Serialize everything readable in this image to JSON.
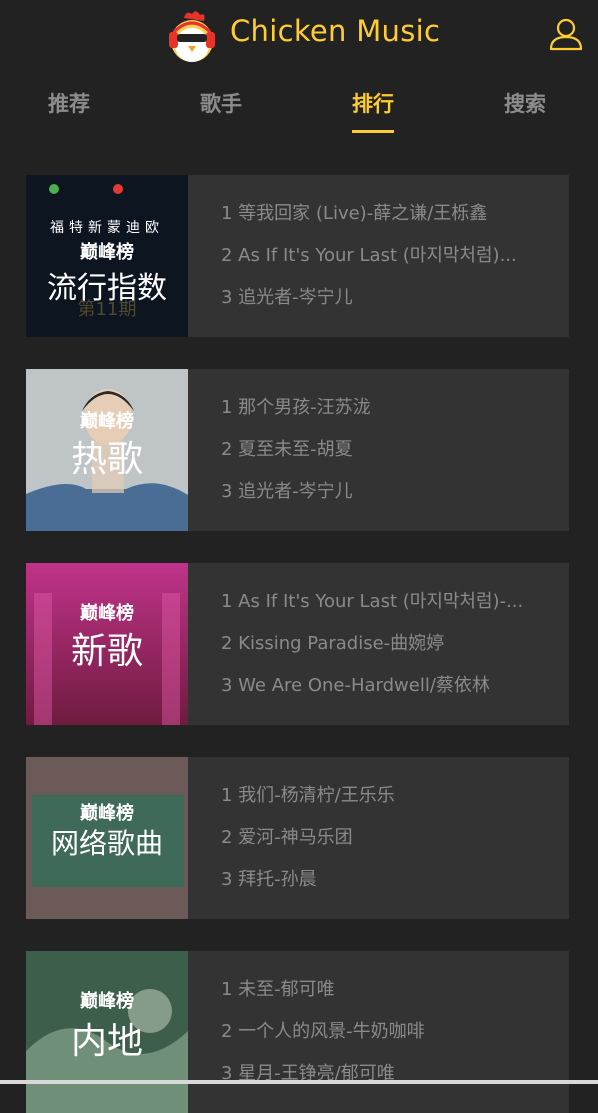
{
  "app": {
    "title": "Chicken Music",
    "logo_icon": "chicken-logo-icon",
    "user_icon": "user-icon"
  },
  "colors": {
    "accent": "#ffcd32",
    "background": "#222222",
    "card": "#333333",
    "text_muted": "#8a8a8a"
  },
  "tabs": [
    {
      "label": "推荐",
      "active": false
    },
    {
      "label": "歌手",
      "active": false
    },
    {
      "label": "排行",
      "active": true
    },
    {
      "label": "搜索",
      "active": false
    }
  ],
  "ranks": [
    {
      "cover_title": "流行指数",
      "cover_top": "福特新蒙迪欧",
      "cover_brand": "巅峰榜",
      "cover_issue": "第11期",
      "songs": [
        "1 等我回家 (Live)-薛之谦/王栎鑫",
        "2 As If It's Your Last (마지막처럼)...",
        "3 追光者-岑宁儿"
      ]
    },
    {
      "cover_title": "热歌",
      "cover_brand": "巅峰榜",
      "songs": [
        "1 那个男孩-汪苏泷",
        "2 夏至未至-胡夏",
        "3 追光者-岑宁儿"
      ]
    },
    {
      "cover_title": "新歌",
      "cover_brand": "巅峰榜",
      "songs": [
        "1 As If It's Your Last (마지막처럼)-...",
        "2 Kissing Paradise-曲婉婷",
        "3 We Are One-Hardwell/蔡依林"
      ]
    },
    {
      "cover_title": "网络歌曲",
      "cover_brand": "巅峰榜",
      "songs": [
        "1 我们-杨清柠/王乐乐",
        "2 爱河-神马乐团",
        "3 拜托-孙晨"
      ]
    },
    {
      "cover_title": "内地",
      "cover_brand": "巅峰榜",
      "songs": [
        "1 未至-郁可唯",
        "2 一个人的风景-牛奶咖啡",
        "3 星月-王铮亮/郁可唯"
      ]
    }
  ]
}
